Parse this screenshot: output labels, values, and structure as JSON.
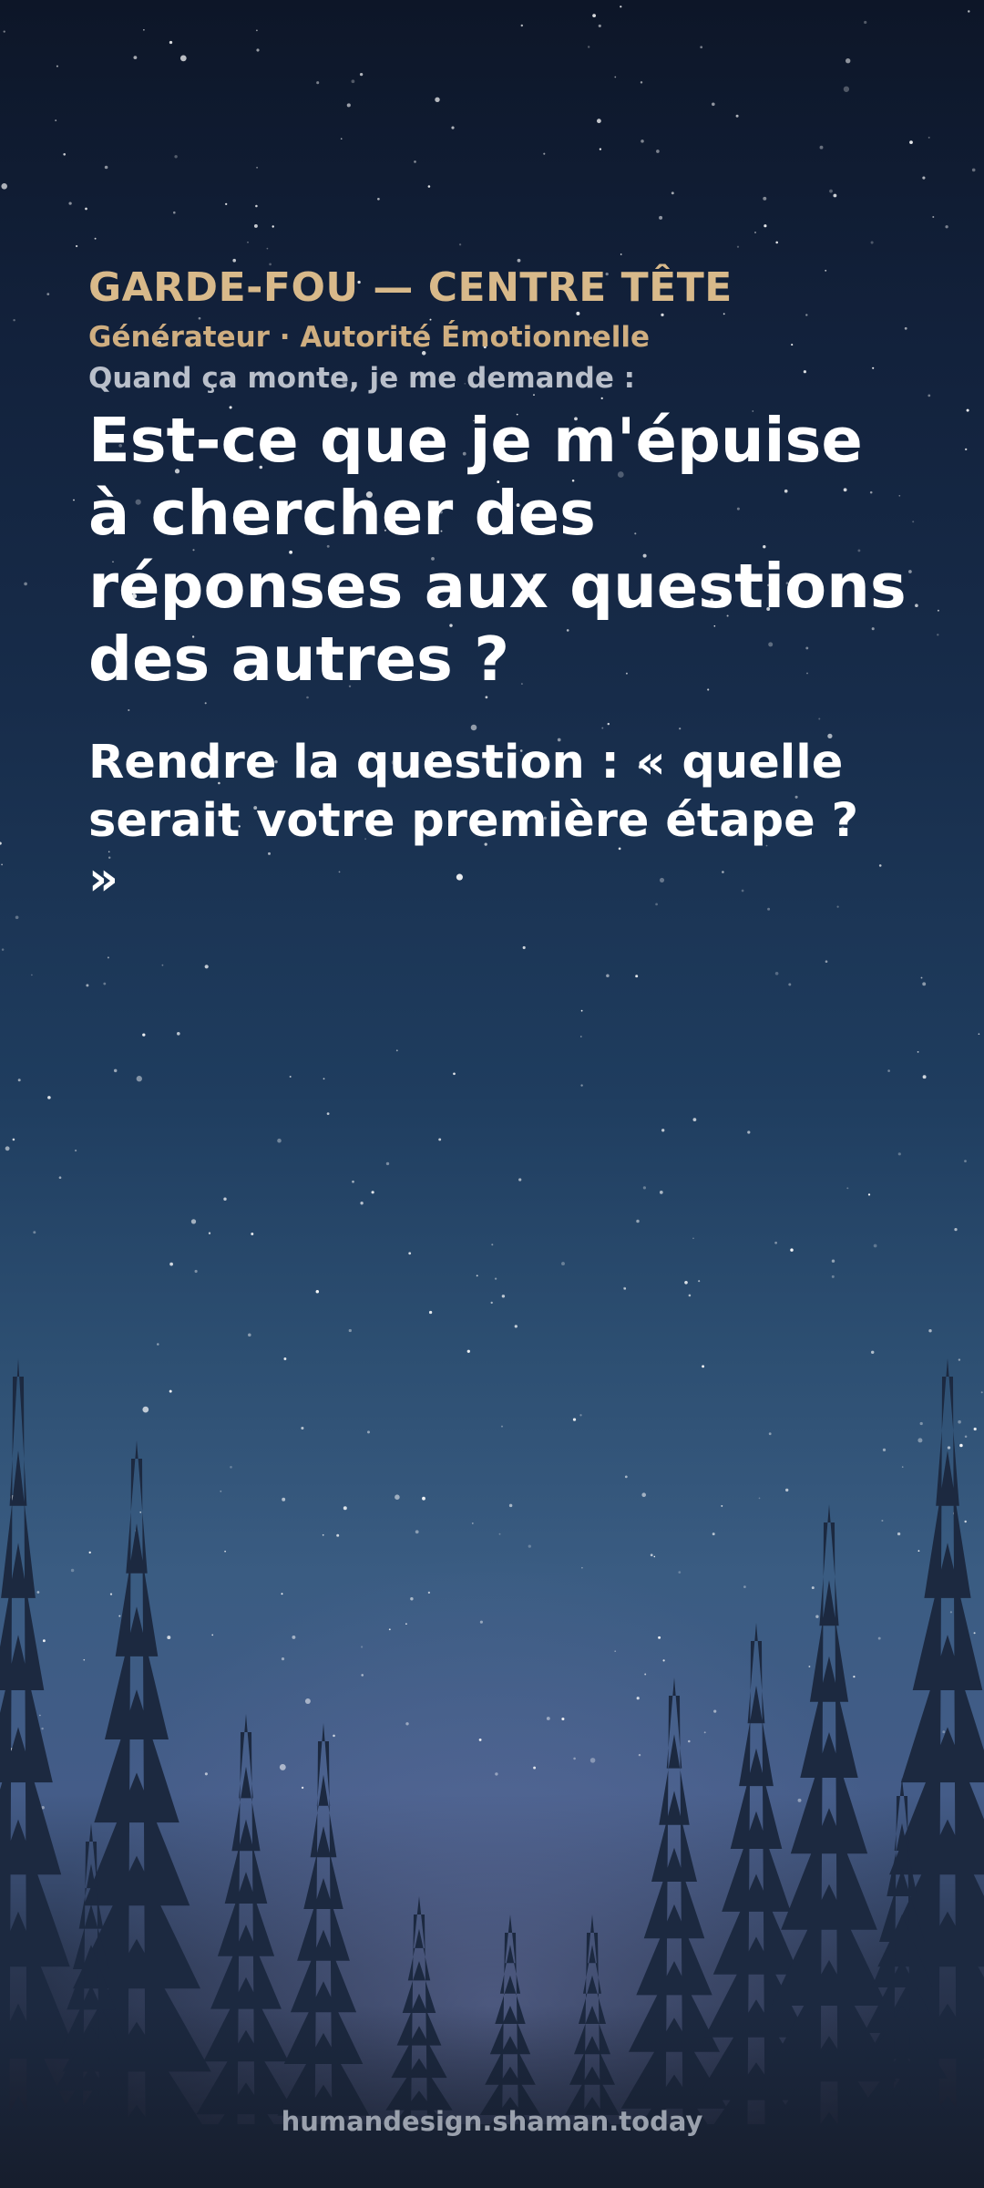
{
  "card": {
    "kicker": "GARDE-FOU — CENTRE TÊTE",
    "subtitle": "Générateur · Autorité Émotionnelle",
    "prompt": "Quand ça monte, je me demande :",
    "question": "Est-ce que je m'épuise à chercher des réponses aux questions des autres ?",
    "answer": "Rendre la question : « quelle serait votre première étape ? »"
  },
  "footer": {
    "site": "humandesign.shaman.today"
  },
  "colors": {
    "accent": "#d8b98a",
    "text": "#ffffff",
    "muted": "#b9bfca"
  }
}
